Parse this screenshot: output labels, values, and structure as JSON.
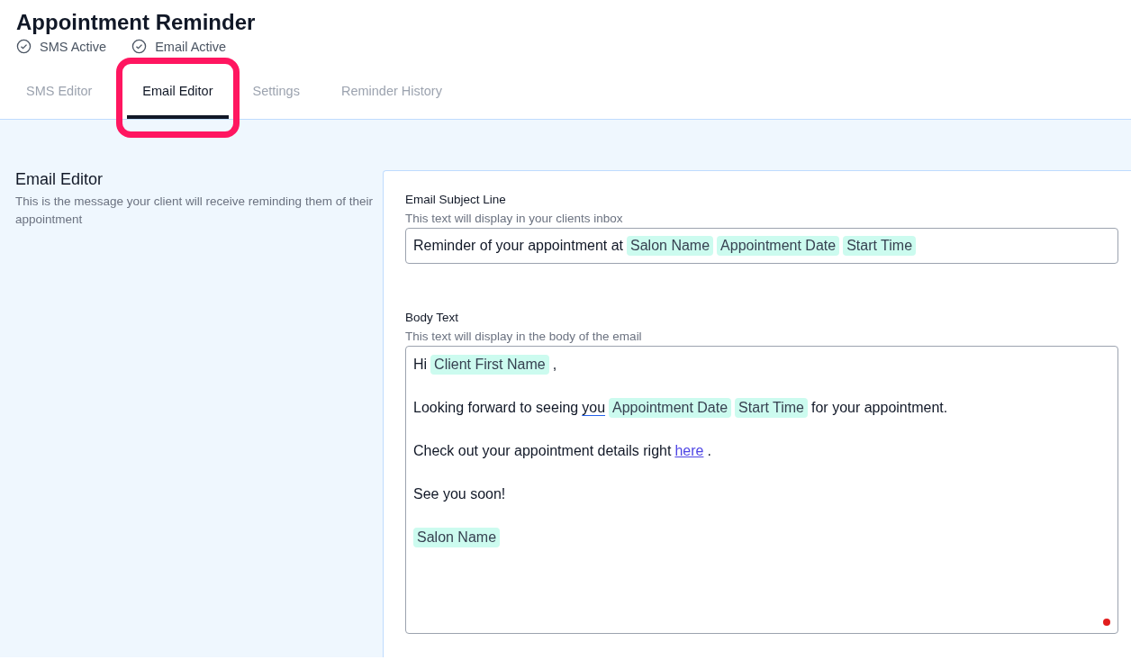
{
  "header": {
    "title": "Appointment Reminder",
    "statuses": [
      {
        "label": "SMS Active",
        "active": true
      },
      {
        "label": "Email Active",
        "active": true
      }
    ]
  },
  "tabs": [
    {
      "label": "SMS Editor",
      "selected": false,
      "highlighted": false
    },
    {
      "label": "Email Editor",
      "selected": true,
      "highlighted": true
    },
    {
      "label": "Settings",
      "selected": false,
      "highlighted": false
    },
    {
      "label": "Reminder History",
      "selected": false,
      "highlighted": false
    }
  ],
  "section": {
    "title": "Email Editor",
    "description": "This is the message your client will receive reminding them of their appointment"
  },
  "subject": {
    "label": "Email Subject Line",
    "hint": "This text will display in your clients inbox",
    "parts": [
      {
        "kind": "text",
        "text": "Reminder of your appointment at"
      },
      {
        "kind": "token",
        "text": "Salon Name"
      },
      {
        "kind": "token",
        "text": "Appointment Date"
      },
      {
        "kind": "token",
        "text": "Start Time"
      }
    ]
  },
  "body": {
    "label": "Body Text",
    "hint": "This text will display in the body of the email",
    "lines": [
      [
        {
          "kind": "text",
          "text": "Hi"
        },
        {
          "kind": "token",
          "text": "Client First Name"
        },
        {
          "kind": "text",
          "text": ","
        }
      ],
      [
        {
          "kind": "text",
          "text": "Looking forward to seeing"
        },
        {
          "kind": "underlined",
          "text": "you"
        },
        {
          "kind": "token",
          "text": "Appointment Date"
        },
        {
          "kind": "token",
          "text": "Start Time"
        },
        {
          "kind": "text",
          "text": "for your appointment."
        }
      ],
      [
        {
          "kind": "text",
          "text": "Check out your appointment details right"
        },
        {
          "kind": "link",
          "text": "here"
        },
        {
          "kind": "text",
          "text": "."
        }
      ],
      [
        {
          "kind": "text",
          "text": "See you soon!"
        }
      ],
      [
        {
          "kind": "token",
          "text": "Salon Name"
        }
      ]
    ]
  }
}
